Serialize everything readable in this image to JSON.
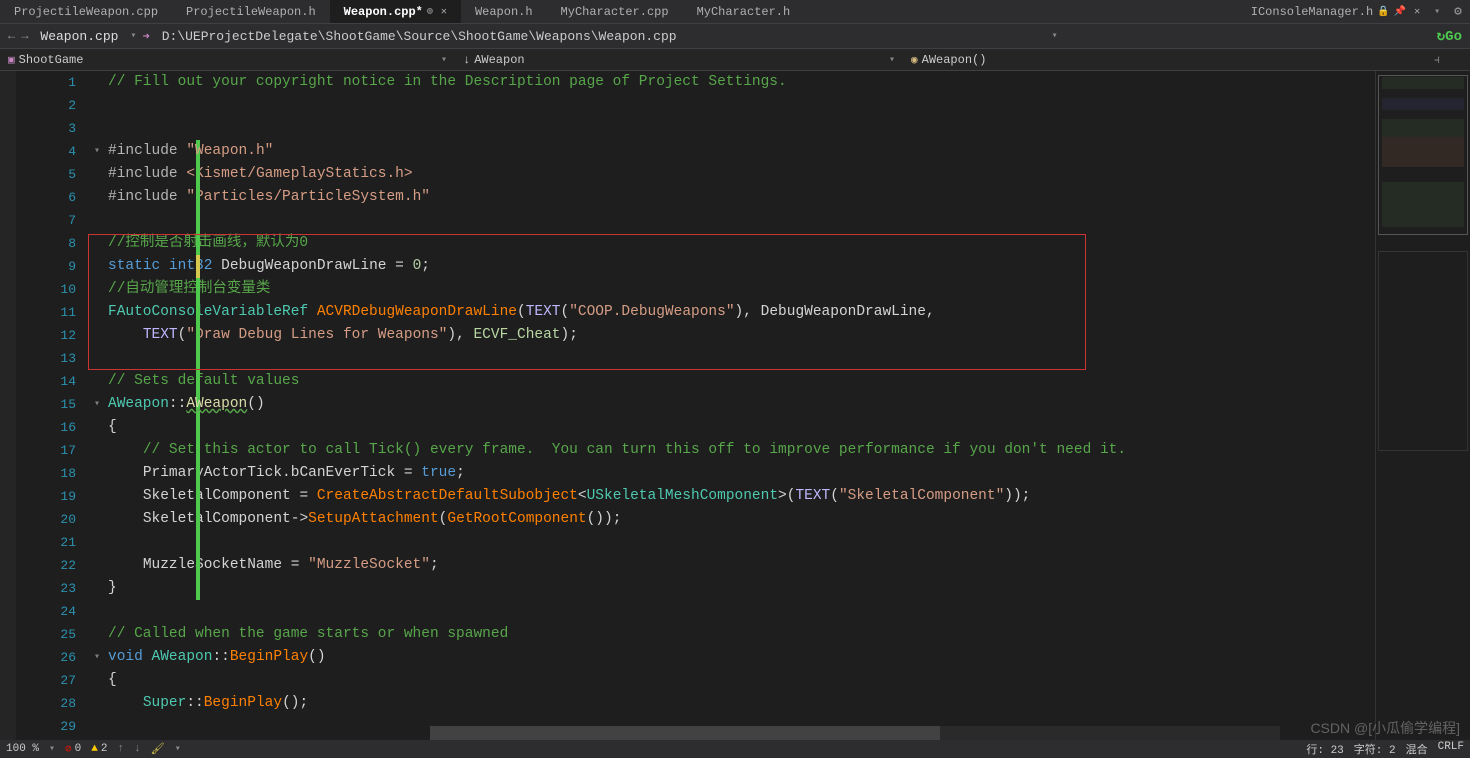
{
  "tabs": {
    "list": [
      "ProjectileWeapon.cpp",
      "ProjectileWeapon.h",
      "Weapon.cpp*",
      "Weapon.h",
      "MyCharacter.cpp",
      "MyCharacter.h"
    ],
    "active_index": 2,
    "right_tab": "IConsoleManager.h"
  },
  "toolbar": {
    "filename": "Weapon.cpp",
    "path": "D:\\UEProjectDelegate\\ShootGame\\Source\\ShootGame\\Weapons\\Weapon.cpp",
    "go": "Go"
  },
  "breadcrumb": {
    "seg1": "ShootGame",
    "seg2": "AWeapon",
    "seg3": "AWeapon()"
  },
  "code": {
    "lines": [
      {
        "n": 1,
        "html": "<span class='cm'>// Fill out your copyright notice in the Description page of Project Settings.</span>"
      },
      {
        "n": 2,
        "html": ""
      },
      {
        "n": 3,
        "html": ""
      },
      {
        "n": 4,
        "fold": "v",
        "html": "<span class='op'>#include </span><span class='str'>\"Weapon.h\"</span>"
      },
      {
        "n": 5,
        "html": "<span class='op'>#include </span><span class='str'>&lt;Kismet/GameplayStatics.h&gt;</span>"
      },
      {
        "n": 6,
        "html": "<span class='op'>#include </span><span class='str'>\"Particles/ParticleSystem.h\"</span>"
      },
      {
        "n": 7,
        "html": ""
      },
      {
        "n": 8,
        "html": "<span class='cm'>//控制是否射击画线，默认为0</span>"
      },
      {
        "n": 9,
        "html": "<span class='kw'>static</span> <span class='kw'>int32</span> <span class='w'>DebugWeaponDrawLine = </span><span class='num'>0</span><span class='w'>;</span>"
      },
      {
        "n": 10,
        "html": "<span class='cm'>//自动管理控制台变量类</span>"
      },
      {
        "n": 11,
        "html": "<span class='typ'>FAutoConsoleVariableRef</span> <span class='fn2'>ACVRDebugWeaponDrawLine</span><span class='w'>(</span><span class='mac'>TEXT</span><span class='w'>(</span><span class='str'>\"COOP.DebugWeapons\"</span><span class='w'>), DebugWeaponDrawLine,</span>"
      },
      {
        "n": 12,
        "html": "    <span class='mac'>TEXT</span><span class='w'>(</span><span class='str'>\"Draw Debug Lines for Weapons\"</span><span class='w'>), </span><span class='enum'>ECVF_Cheat</span><span class='w'>);</span>"
      },
      {
        "n": 13,
        "html": ""
      },
      {
        "n": 14,
        "html": "<span class='cm'>// Sets default values</span>"
      },
      {
        "n": 15,
        "fold": "v",
        "html": "<span class='typ'>AWeapon</span><span class='w'>::</span><span style='color:#dcdcaa;text-decoration:underline wavy #57a64a;'>AWeapon</span><span class='w'>()</span>"
      },
      {
        "n": 16,
        "html": "<span class='w'>{</span>"
      },
      {
        "n": 17,
        "html": "    <span class='cm'>// Set this actor to call Tick() every frame.  You can turn this off to improve performance if you don't need it.</span>"
      },
      {
        "n": 18,
        "html": "    <span class='w'>PrimaryActorTick</span><span class='w'>.bCanEverTick = </span><span class='kw'>true</span><span class='w'>;</span>"
      },
      {
        "n": 19,
        "html": "    <span class='w'>SkeletalComponent = </span><span class='fn2'>CreateAbstractDefaultSubobject</span><span class='w'>&lt;</span><span class='typ'>USkeletalMeshComponent</span><span class='w'>&gt;(</span><span class='mac'>TEXT</span><span class='w'>(</span><span class='str'>\"SkeletalComponent\"</span><span class='w'>));</span>"
      },
      {
        "n": 20,
        "html": "    <span class='w'>SkeletalComponent-&gt;</span><span class='fn2'>SetupAttachment</span><span class='w'>(</span><span class='fn2'>GetRootComponent</span><span class='w'>());</span>"
      },
      {
        "n": 21,
        "html": ""
      },
      {
        "n": 22,
        "html": "    <span class='w'>MuzzleSocketName = </span><span class='str'>\"MuzzleSocket\"</span><span class='w'>;</span>"
      },
      {
        "n": 23,
        "html": "<span class='w'>}</span>"
      },
      {
        "n": 24,
        "html": ""
      },
      {
        "n": 25,
        "html": "<span class='cm'>// Called when the game starts or when spawned</span>"
      },
      {
        "n": 26,
        "fold": "v",
        "html": "<span class='kw'>void</span> <span class='typ'>AWeapon</span><span class='w'>::</span><span class='fn2'>BeginPlay</span><span class='w'>()</span>"
      },
      {
        "n": 27,
        "html": "<span class='w'>{</span>"
      },
      {
        "n": 28,
        "html": "    <span class='typ'>Super</span><span class='w'>::</span><span class='fn2'>BeginPlay</span><span class='w'>();</span>"
      },
      {
        "n": 29,
        "html": ""
      }
    ]
  },
  "status": {
    "zoom": "100 %",
    "err": "0",
    "warn": "2",
    "line_label": "行:",
    "line": "23",
    "char_label": "字符:",
    "char": "2",
    "indent": "混合",
    "crlf": "CRLF"
  },
  "watermark": "CSDN @[小瓜偷学编程]"
}
